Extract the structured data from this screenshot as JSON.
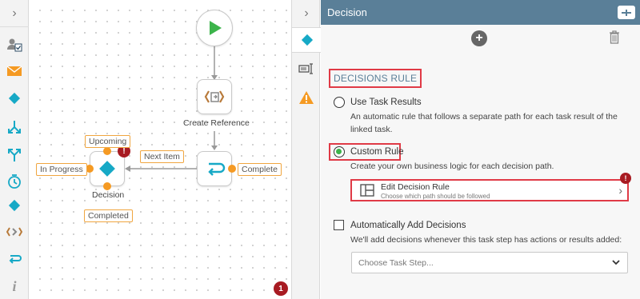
{
  "canvas": {
    "nodes": {
      "create_reference": "Create Reference",
      "decision": "Decision"
    },
    "connectors": {
      "upcoming": "Upcoming",
      "in_progress": "In Progress",
      "completed": "Completed",
      "next_item": "Next Item",
      "complete": "Complete"
    },
    "footer_badge": "1",
    "error_badge": "!"
  },
  "panel": {
    "title": "Decision",
    "section_title": "DECISIONS RULE",
    "options": {
      "use_task_results": {
        "label": "Use Task Results",
        "description": "An automatic rule that follows a separate path for each task result of the linked task.",
        "selected": false
      },
      "custom_rule": {
        "label": "Custom Rule",
        "description": "Create your own business logic for each decision path.",
        "selected": true
      }
    },
    "edit_rule": {
      "title": "Edit Decision Rule",
      "subtitle": "Choose which path should be followed",
      "badge": "!"
    },
    "auto_add": {
      "label": "Automatically Add Decisions",
      "description": "We'll add decisions whenever this task step has actions or results added:",
      "checked": false
    },
    "select": {
      "placeholder": "Choose Task Step..."
    }
  },
  "colors": {
    "header": "#5a7f98",
    "accent_teal": "#17a9c6",
    "orange": "#f59a23",
    "highlight": "#e03a46",
    "green": "#3cb44b",
    "badge_red": "#a81b22"
  }
}
